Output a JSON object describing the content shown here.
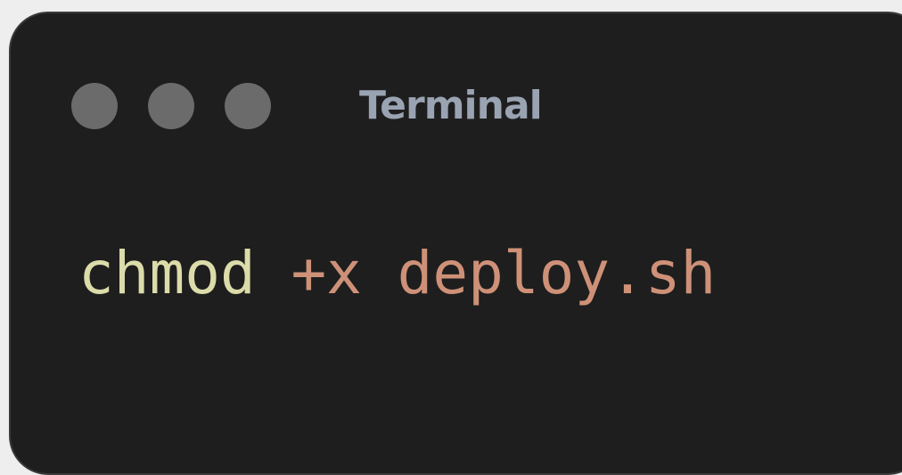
{
  "window": {
    "title": "Terminal",
    "background_color": "#1e1e1e",
    "window_controls": [
      {
        "name": "close-dot",
        "color": "#6b6b6b"
      },
      {
        "name": "minimize-dot",
        "color": "#6b6b6b"
      },
      {
        "name": "maximize-dot",
        "color": "#6b6b6b"
      }
    ]
  },
  "command": {
    "program": "chmod",
    "flag": "+x",
    "argument": "deploy.sh",
    "program_color": "#dcdcaa",
    "flag_color": "#ce9178",
    "argument_color": "#ce9178"
  }
}
